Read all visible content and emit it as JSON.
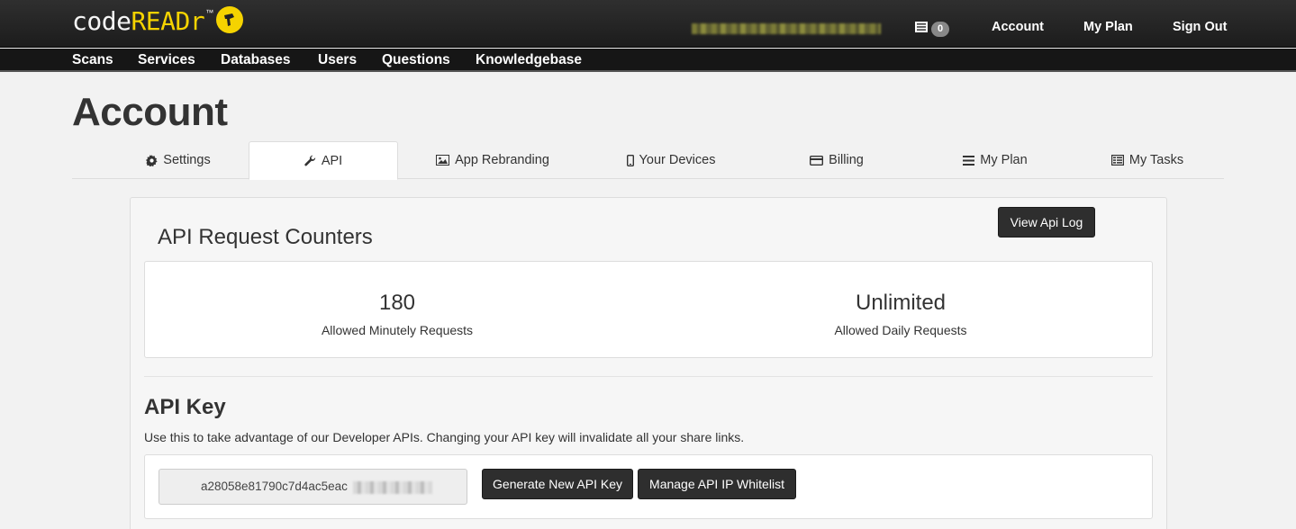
{
  "header": {
    "logo": {
      "part1": "code",
      "part2": "READr",
      "tm": "™"
    },
    "inbox_count": "0",
    "links": [
      "Account",
      "My Plan",
      "Sign Out"
    ]
  },
  "nav": [
    "Scans",
    "Services",
    "Databases",
    "Users",
    "Questions",
    "Knowledgebase"
  ],
  "page": {
    "title": "Account"
  },
  "tabs": [
    {
      "label": "Settings",
      "icon": "gear-icon"
    },
    {
      "label": "API",
      "icon": "wrench-icon",
      "active": true
    },
    {
      "label": "App Rebranding",
      "icon": "picture-icon"
    },
    {
      "label": "Your Devices",
      "icon": "mobile-phone-icon"
    },
    {
      "label": "Billing",
      "icon": "credit-card-icon"
    },
    {
      "label": "My Plan",
      "icon": "list-icon"
    },
    {
      "label": "My Tasks",
      "icon": "tasks-icon"
    }
  ],
  "api": {
    "view_log_button": "View Api Log",
    "counters_heading": "API Request Counters",
    "counters": [
      {
        "value": "180",
        "label": "Allowed Minutely Requests"
      },
      {
        "value": "Unlimited",
        "label": "Allowed Daily Requests"
      }
    ],
    "key_heading": "API Key",
    "key_description": "Use this to take advantage of our Developer APIs. Changing your API key will invalidate all your share links.",
    "key_value": "a28058e81790c7d4ac5eac",
    "generate_button": "Generate New API Key",
    "whitelist_button": "Manage API IP Whitelist"
  },
  "colors": {
    "brand_yellow": "#f5d300",
    "header_bg": "#1c1c1c",
    "button_dark": "#2e2e2e"
  }
}
